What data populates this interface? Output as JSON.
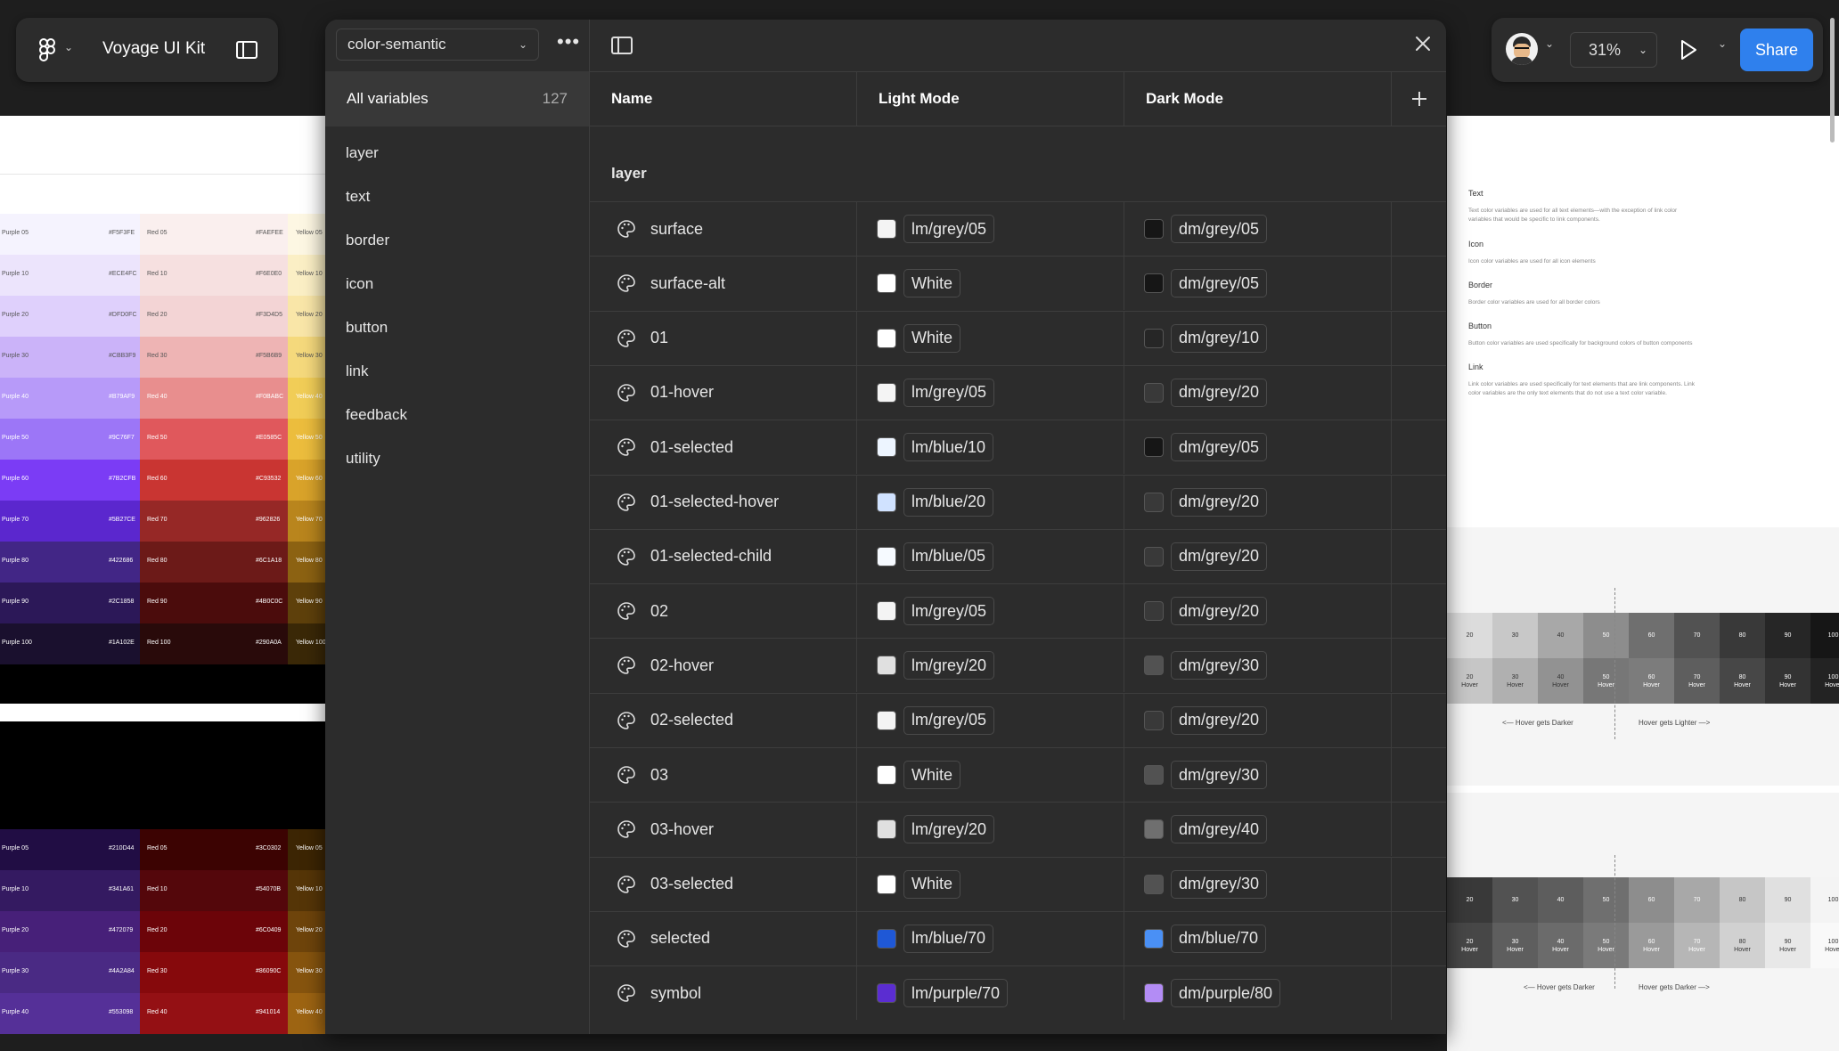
{
  "file_title": "Voyage UI Kit",
  "zoom": "31%",
  "share_label": "Share",
  "collection": "color-semantic",
  "all_variables_label": "All variables",
  "all_variables_count": "127",
  "groups": [
    "layer",
    "text",
    "border",
    "icon",
    "button",
    "link",
    "feedback",
    "utility"
  ],
  "columns": {
    "name": "Name",
    "light": "Light Mode",
    "dark": "Dark Mode"
  },
  "group_title": "layer",
  "variables": [
    {
      "name": "surface",
      "light": "lm/grey/05",
      "light_color": "#f4f4f4",
      "dark": "dm/grey/05",
      "dark_color": "#161616"
    },
    {
      "name": "surface-alt",
      "light": "White",
      "light_color": "#ffffff",
      "dark": "dm/grey/05",
      "dark_color": "#161616"
    },
    {
      "name": "01",
      "light": "White",
      "light_color": "#ffffff",
      "dark": "dm/grey/10",
      "dark_color": "#262626"
    },
    {
      "name": "01-hover",
      "light": "lm/grey/05",
      "light_color": "#f4f4f4",
      "dark": "dm/grey/20",
      "dark_color": "#393939"
    },
    {
      "name": "01-selected",
      "light": "lm/blue/10",
      "light_color": "#edf5ff",
      "dark": "dm/grey/05",
      "dark_color": "#161616"
    },
    {
      "name": "01-selected-hover",
      "light": "lm/blue/20",
      "light_color": "#d0e2ff",
      "dark": "dm/grey/20",
      "dark_color": "#393939"
    },
    {
      "name": "01-selected-child",
      "light": "lm/blue/05",
      "light_color": "#f6faff",
      "dark": "dm/grey/20",
      "dark_color": "#393939"
    },
    {
      "name": "02",
      "light": "lm/grey/05",
      "light_color": "#f4f4f4",
      "dark": "dm/grey/20",
      "dark_color": "#393939"
    },
    {
      "name": "02-hover",
      "light": "lm/grey/20",
      "light_color": "#e0e0e0",
      "dark": "dm/grey/30",
      "dark_color": "#525252"
    },
    {
      "name": "02-selected",
      "light": "lm/grey/05",
      "light_color": "#f4f4f4",
      "dark": "dm/grey/20",
      "dark_color": "#393939"
    },
    {
      "name": "03",
      "light": "White",
      "light_color": "#ffffff",
      "dark": "dm/grey/30",
      "dark_color": "#525252"
    },
    {
      "name": "03-hover",
      "light": "lm/grey/20",
      "light_color": "#e0e0e0",
      "dark": "dm/grey/40",
      "dark_color": "#6f6f6f"
    },
    {
      "name": "03-selected",
      "light": "White",
      "light_color": "#ffffff",
      "dark": "dm/grey/30",
      "dark_color": "#525252"
    },
    {
      "name": "selected",
      "light": "lm/blue/70",
      "light_color": "#1f58d6",
      "dark": "dm/blue/70",
      "dark_color": "#4a90f5"
    },
    {
      "name": "symbol",
      "light": "lm/purple/70",
      "light_color": "#5b2dd1",
      "dark": "dm/purple/80",
      "dark_color": "#b38cf5"
    }
  ],
  "right_panel": [
    {
      "title": "Text",
      "desc": "Text color variables are used for all text elements—with the exception of link color variables that would be specific to link components."
    },
    {
      "title": "Icon",
      "desc": "Icon color variables are used for all icon elements"
    },
    {
      "title": "Border",
      "desc": "Border color variables are used for all border colors"
    },
    {
      "title": "Button",
      "desc": "Button color variables are used specifically for background colors of button components"
    },
    {
      "title": "Link",
      "desc": "Link color variables are used specifically for text elements that are link components. Link color variables are the only text elements that do not use a text color variable."
    }
  ],
  "ramp_labels": [
    "20",
    "30",
    "40",
    "50",
    "60",
    "70",
    "80",
    "90",
    "100"
  ],
  "ramp_hover_label": "Hover",
  "ramp_note_left": "<— Hover gets Darker",
  "ramp_note_right": "Hover gets Lighter —>",
  "ramp2_note_left": "<— Hover gets Darker",
  "ramp2_note_right": "Hover gets Darker —>",
  "swatches_light": [
    {
      "p": "Purple 05",
      "ph": "#F5F3FE",
      "r": "Red 05",
      "rh": "#FAEFEE",
      "y": "Yellow 05",
      "pc": "#f5f3fe",
      "rc": "#faefee",
      "yc": "#fdf7e3"
    },
    {
      "p": "Purple 10",
      "ph": "#ECE4FC",
      "r": "Red 10",
      "rh": "#F6E0E0",
      "y": "Yellow 10",
      "pc": "#ece4fc",
      "rc": "#f6e0e0",
      "yc": "#fbefc5"
    },
    {
      "p": "Purple 20",
      "ph": "#DFD0FC",
      "r": "Red 20",
      "rh": "#F3D4D5",
      "y": "Yellow 20",
      "pc": "#dfd0fc",
      "rc": "#f3d4d5",
      "yc": "#f9e6a8"
    },
    {
      "p": "Purple 30",
      "ph": "#CBB3F9",
      "r": "Red 30",
      "rh": "#F5B6B9",
      "y": "Yellow 30",
      "pc": "#cbb3f9",
      "rc": "#eeb4b4",
      "yc": "#f5d97c"
    },
    {
      "p": "Purple 40",
      "ph": "#B79AF9",
      "r": "Red 40",
      "rh": "#F0BABC",
      "y": "Yellow 40",
      "pc": "#b79af9",
      "rc": "#e88e8e",
      "yc": "#f1cd57"
    },
    {
      "p": "Purple 50",
      "ph": "#9C76F7",
      "r": "Red 50",
      "rh": "#E0585C",
      "y": "Yellow 50",
      "pc": "#9c76f7",
      "rc": "#e0585c",
      "yc": "#ecbd3d"
    },
    {
      "p": "Purple 60",
      "ph": "#7B2CFB",
      "r": "Red 60",
      "rh": "#C93532",
      "y": "Yellow 60",
      "pc": "#7b3cf5",
      "rc": "#c93532",
      "yc": "#d9a32a"
    },
    {
      "p": "Purple 70",
      "ph": "#5B27CE",
      "r": "Red 70",
      "rh": "#962826",
      "y": "Yellow 70",
      "pc": "#5b27ce",
      "rc": "#962826",
      "yc": "#b9851d"
    },
    {
      "p": "Purple 80",
      "ph": "#422686",
      "r": "Red 80",
      "rh": "#6C1A18",
      "y": "Yellow 80",
      "pc": "#422686",
      "rc": "#6c1a18",
      "yc": "#8c6212"
    },
    {
      "p": "Purple 90",
      "ph": "#2C1858",
      "r": "Red 90",
      "rh": "#4B0C0C",
      "y": "Yellow 90",
      "pc": "#2c1858",
      "rc": "#4b0c0c",
      "yc": "#5e400b"
    },
    {
      "p": "Purple 100",
      "ph": "#1A102E",
      "r": "Red 100",
      "rh": "#290A0A",
      "y": "Yellow 100",
      "pc": "#1a102e",
      "rc": "#290a0a",
      "yc": "#3a2807"
    }
  ],
  "swatches_dark": [
    {
      "p": "Purple 05",
      "ph": "#210D44",
      "r": "Red 05",
      "rh": "#3C0302",
      "y": "Yellow 05",
      "pc": "#210d44",
      "rc": "#3c0302",
      "yc": "#3c2503"
    },
    {
      "p": "Purple 10",
      "ph": "#341A61",
      "r": "Red 10",
      "rh": "#54070B",
      "y": "Yellow 10",
      "pc": "#341a61",
      "rc": "#54070b",
      "yc": "#553507"
    },
    {
      "p": "Purple 20",
      "ph": "#472079",
      "r": "Red 20",
      "rh": "#6C0409",
      "y": "Yellow 20",
      "pc": "#472079",
      "rc": "#6c0409",
      "yc": "#6e440b"
    },
    {
      "p": "Purple 30",
      "ph": "#4A2A84",
      "r": "Red 30",
      "rh": "#86090C",
      "y": "Yellow 30",
      "pc": "#4a2a84",
      "rc": "#86090c",
      "yc": "#86540e"
    },
    {
      "p": "Purple 40",
      "ph": "#553098",
      "r": "Red 40",
      "rh": "#941014",
      "y": "Yellow 40",
      "pc": "#553098",
      "rc": "#941014",
      "yc": "#9d6412"
    }
  ]
}
